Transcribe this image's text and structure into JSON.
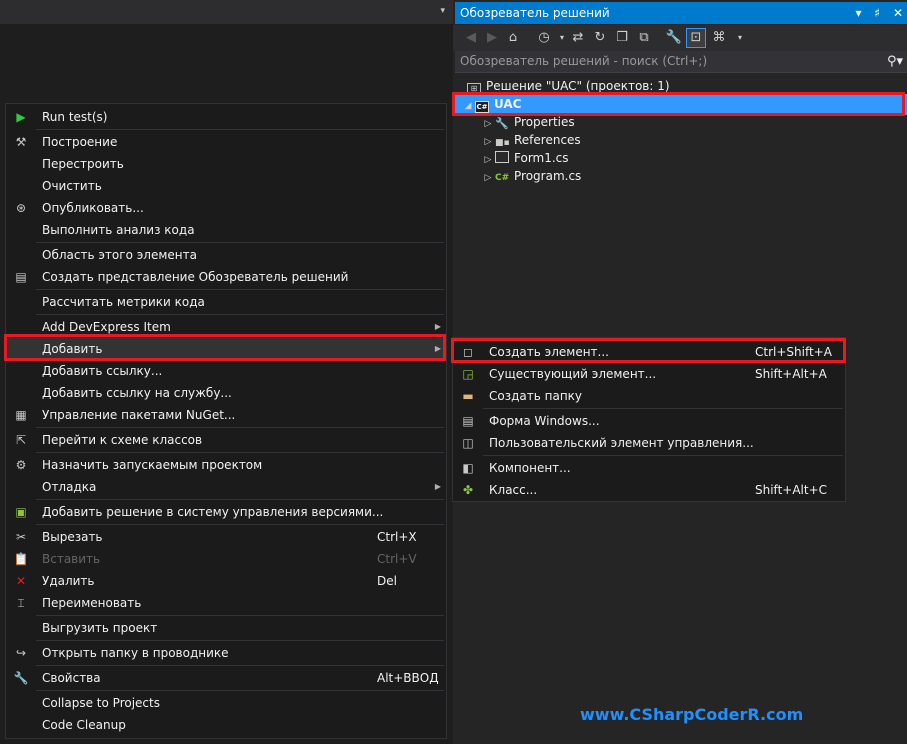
{
  "top_strip": {
    "dropdown_glyph": "▾"
  },
  "solution_explorer": {
    "title": "Обозреватель решений",
    "title_controls": [
      "▾",
      "♯",
      "✕"
    ],
    "search_placeholder": "Обозреватель решений - поиск (Ctrl+;)",
    "tree": {
      "solution": "Решение \"UAC\"  (проектов: 1)",
      "project": "UAC",
      "children": [
        "Properties",
        "References",
        "Form1.cs",
        "Program.cs"
      ]
    }
  },
  "context_menu": {
    "items": [
      {
        "label": "Run test(s)",
        "shortcut": "",
        "icon": "run-icon"
      },
      {
        "label": "Построение",
        "shortcut": "",
        "icon": "build-icon"
      },
      {
        "label": "Перестроить",
        "shortcut": ""
      },
      {
        "label": "Очистить",
        "shortcut": ""
      },
      {
        "label": "Опубликовать...",
        "shortcut": "",
        "icon": "publish-icon"
      },
      {
        "label": "Выполнить анализ кода",
        "shortcut": ""
      },
      {
        "label": "Область этого элемента",
        "shortcut": ""
      },
      {
        "label": "Создать представление Обозреватель решений",
        "shortcut": "",
        "icon": "new-view-icon"
      },
      {
        "label": "Рассчитать метрики кода",
        "shortcut": ""
      },
      {
        "label": "Add DevExpress Item",
        "shortcut": "",
        "submenu": true
      },
      {
        "label": "Добавить",
        "shortcut": "",
        "submenu": true
      },
      {
        "label": "Добавить ссылку...",
        "shortcut": ""
      },
      {
        "label": "Добавить ссылку на службу...",
        "shortcut": ""
      },
      {
        "label": "Управление пакетами NuGet...",
        "shortcut": "",
        "icon": "nuget-icon"
      },
      {
        "label": "Перейти к схеме классов",
        "shortcut": "",
        "icon": "class-diagram-icon"
      },
      {
        "label": "Назначить запускаемым проектом",
        "shortcut": "",
        "icon": "gear-icon"
      },
      {
        "label": "Отладка",
        "shortcut": "",
        "submenu": true
      },
      {
        "label": "Добавить решение в систему управления версиями...",
        "shortcut": "",
        "icon": "source-control-icon"
      },
      {
        "label": "Вырезать",
        "shortcut": "Ctrl+X",
        "icon": "cut-icon"
      },
      {
        "label": "Вставить",
        "shortcut": "Ctrl+V",
        "icon": "paste-icon",
        "disabled": true
      },
      {
        "label": "Удалить",
        "shortcut": "Del",
        "icon": "delete-icon"
      },
      {
        "label": "Переименовать",
        "shortcut": "",
        "icon": "rename-icon"
      },
      {
        "label": "Выгрузить проект",
        "shortcut": ""
      },
      {
        "label": "Открыть папку в проводнике",
        "shortcut": "",
        "icon": "open-folder-icon"
      },
      {
        "label": "Свойства",
        "shortcut": "Alt+ВВОД",
        "icon": "wrench-icon"
      },
      {
        "label": "Collapse to Projects",
        "shortcut": ""
      },
      {
        "label": "Code Cleanup",
        "shortcut": ""
      }
    ]
  },
  "add_submenu": {
    "items": [
      {
        "label": "Создать элемент...",
        "shortcut": "Ctrl+Shift+A",
        "icon": "new-item-icon"
      },
      {
        "label": "Существующий элемент...",
        "shortcut": "Shift+Alt+A",
        "icon": "existing-item-icon"
      },
      {
        "label": "Создать папку",
        "shortcut": "",
        "icon": "new-folder-icon"
      },
      {
        "label": "Форма Windows...",
        "shortcut": "",
        "icon": "windows-form-icon"
      },
      {
        "label": "Пользовательский элемент управления...",
        "shortcut": "",
        "icon": "user-control-icon"
      },
      {
        "label": "Компонент...",
        "shortcut": "",
        "icon": "component-icon"
      },
      {
        "label": "Класс...",
        "shortcut": "Shift+Alt+C",
        "icon": "class-icon"
      }
    ]
  },
  "watermark": "www.CSharpCoderR.com",
  "colors": {
    "accent": "#007acc",
    "selection": "#3399ff",
    "highlight_frame": "#e51b24",
    "watermark": "#1e90ff"
  }
}
